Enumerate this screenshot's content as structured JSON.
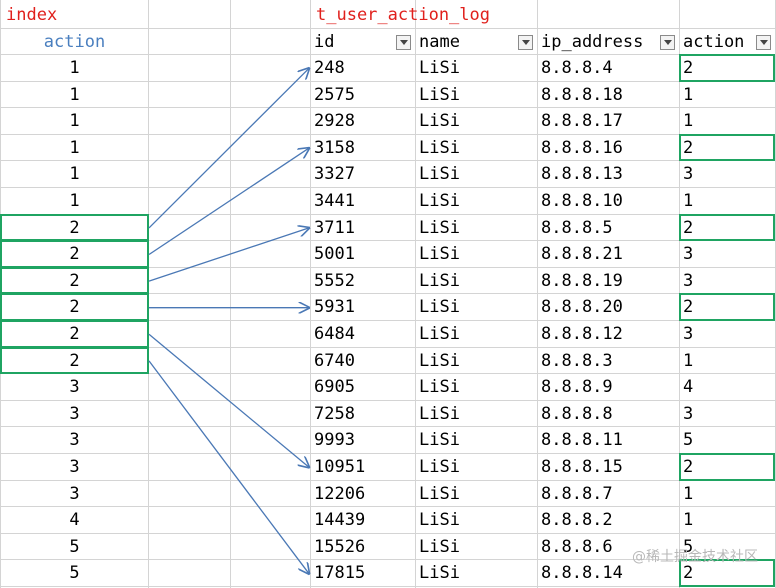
{
  "index_sheet": {
    "title": "index",
    "column_header": "action",
    "values": [
      "1",
      "1",
      "1",
      "1",
      "1",
      "1",
      "2",
      "2",
      "2",
      "2",
      "2",
      "2",
      "3",
      "3",
      "3",
      "3",
      "3",
      "4",
      "5",
      "5"
    ]
  },
  "log_table": {
    "title": "t_user_action_log",
    "columns": [
      "id",
      "name",
      "ip_address",
      "action"
    ],
    "rows": [
      [
        "248",
        "LiSi",
        "8.8.8.4",
        "2"
      ],
      [
        "2575",
        "LiSi",
        "8.8.8.18",
        "1"
      ],
      [
        "2928",
        "LiSi",
        "8.8.8.17",
        "1"
      ],
      [
        "3158",
        "LiSi",
        "8.8.8.16",
        "2"
      ],
      [
        "3327",
        "LiSi",
        "8.8.8.13",
        "3"
      ],
      [
        "3441",
        "LiSi",
        "8.8.8.10",
        "1"
      ],
      [
        "3711",
        "LiSi",
        "8.8.8.5",
        "2"
      ],
      [
        "5001",
        "LiSi",
        "8.8.8.21",
        "3"
      ],
      [
        "5552",
        "LiSi",
        "8.8.8.19",
        "3"
      ],
      [
        "5931",
        "LiSi",
        "8.8.8.20",
        "2"
      ],
      [
        "6484",
        "LiSi",
        "8.8.8.12",
        "3"
      ],
      [
        "6740",
        "LiSi",
        "8.8.8.3",
        "1"
      ],
      [
        "6905",
        "LiSi",
        "8.8.8.9",
        "4"
      ],
      [
        "7258",
        "LiSi",
        "8.8.8.8",
        "3"
      ],
      [
        "9993",
        "LiSi",
        "8.8.8.11",
        "5"
      ],
      [
        "10951",
        "LiSi",
        "8.8.8.15",
        "2"
      ],
      [
        "12206",
        "LiSi",
        "8.8.8.7",
        "1"
      ],
      [
        "14439",
        "LiSi",
        "8.8.8.2",
        "1"
      ],
      [
        "15526",
        "LiSi",
        "8.8.8.6",
        "5"
      ],
      [
        "17815",
        "LiSi",
        "8.8.8.14",
        "2"
      ]
    ]
  },
  "highlighted_index_rows": [
    6,
    7,
    8,
    9,
    10,
    11
  ],
  "highlighted_log_rows": [
    0,
    3,
    6,
    9,
    15,
    19
  ],
  "arrow_links": [
    {
      "from_index_row": 6,
      "to_log_row": 0
    },
    {
      "from_index_row": 7,
      "to_log_row": 3
    },
    {
      "from_index_row": 8,
      "to_log_row": 6
    },
    {
      "from_index_row": 9,
      "to_log_row": 9
    },
    {
      "from_index_row": 10,
      "to_log_row": 15
    },
    {
      "from_index_row": 11,
      "to_log_row": 19
    }
  ],
  "watermark": "@稀土掘金技术社区",
  "colors": {
    "title_red": "#e0201c",
    "index_header_blue": "#4a7fbf",
    "highlight_green": "#1fa462",
    "arrow_blue": "#4a78b5",
    "grid_gray": "#d4d4d4"
  }
}
